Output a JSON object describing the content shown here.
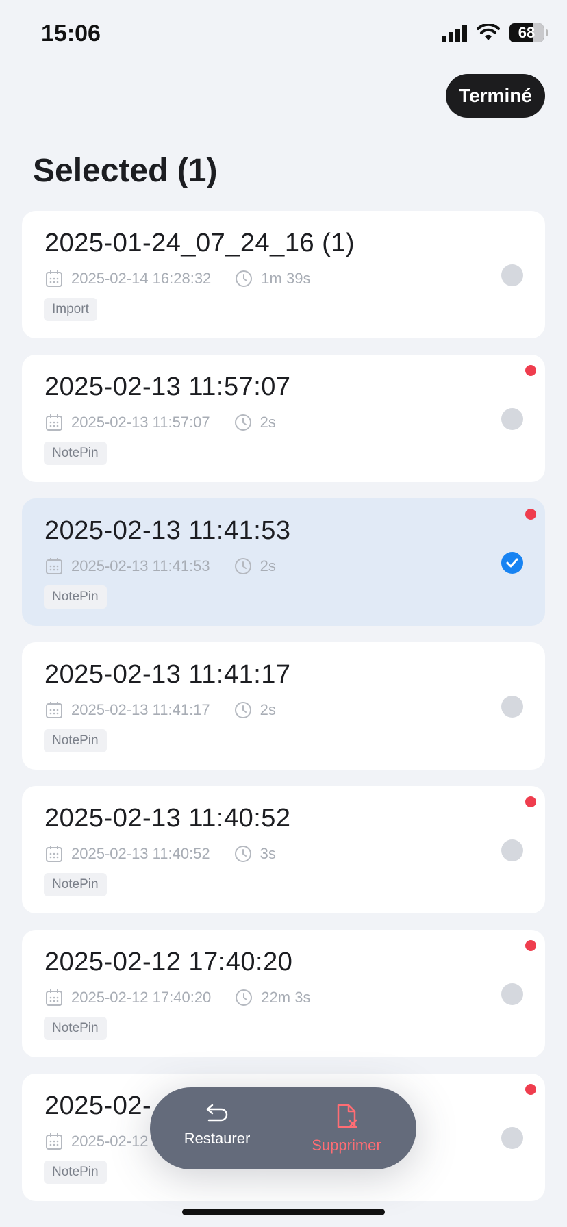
{
  "status": {
    "time": "15:06",
    "battery": "68"
  },
  "header": {
    "done_label": "Terminé",
    "title": "Selected (1)"
  },
  "items": [
    {
      "title": "2025-01-24_07_24_16 (1)",
      "date": "2025-02-14 16:28:32",
      "duration": "1m 39s",
      "tag": "Import",
      "unread": false,
      "selected": false
    },
    {
      "title": "2025-02-13 11:57:07",
      "date": "2025-02-13 11:57:07",
      "duration": "2s",
      "tag": "NotePin",
      "unread": true,
      "selected": false
    },
    {
      "title": "2025-02-13 11:41:53",
      "date": "2025-02-13 11:41:53",
      "duration": "2s",
      "tag": "NotePin",
      "unread": true,
      "selected": true
    },
    {
      "title": "2025-02-13 11:41:17",
      "date": "2025-02-13 11:41:17",
      "duration": "2s",
      "tag": "NotePin",
      "unread": false,
      "selected": false
    },
    {
      "title": "2025-02-13 11:40:52",
      "date": "2025-02-13 11:40:52",
      "duration": "3s",
      "tag": "NotePin",
      "unread": true,
      "selected": false
    },
    {
      "title": "2025-02-12 17:40:20",
      "date": "2025-02-12 17:40:20",
      "duration": "22m 3s",
      "tag": "NotePin",
      "unread": true,
      "selected": false
    },
    {
      "title": "2025-02-",
      "date": "2025-02-12",
      "duration": "",
      "tag": "NotePin",
      "unread": true,
      "selected": false
    }
  ],
  "actions": {
    "restore_label": "Restaurer",
    "delete_label": "Supprimer"
  },
  "colors": {
    "accent": "#1783f2",
    "unread_dot": "#ef3d4e",
    "delete": "#ff6d74",
    "selected_bg": "#e1eaf6"
  },
  "icons": {
    "date": "calendar-icon",
    "duration": "clock-icon",
    "restore": "undo-arrow-icon",
    "delete": "file-delete-icon"
  }
}
